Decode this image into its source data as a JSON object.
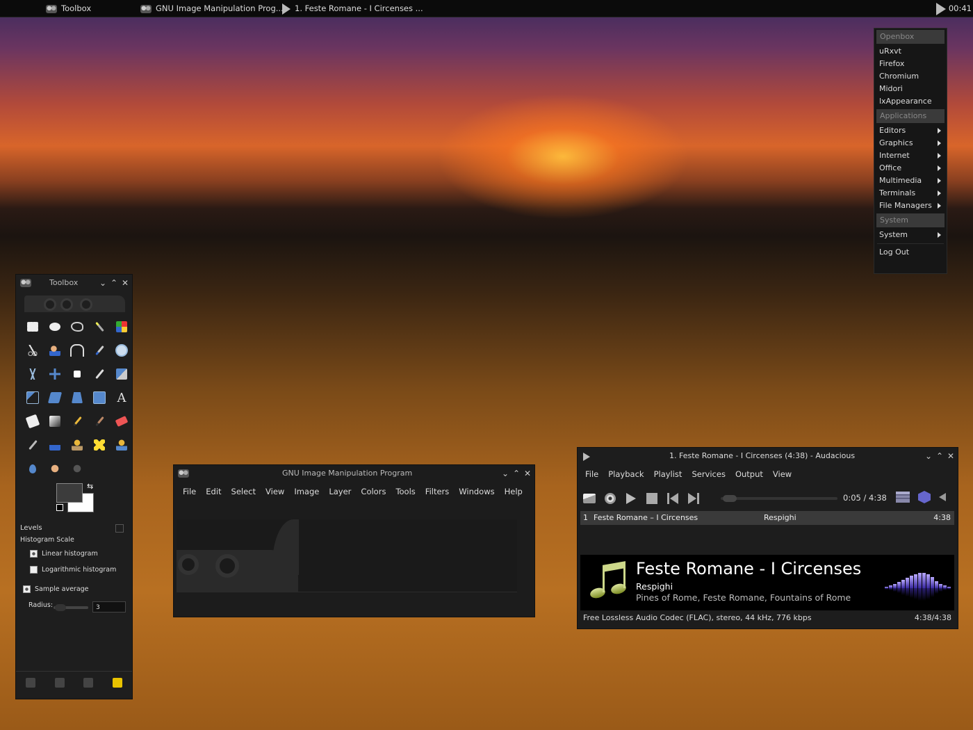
{
  "taskbar": {
    "tasks": [
      "Toolbox",
      "GNU Image Manipulation Prog...",
      "1. Feste Romane - I Circenses ..."
    ],
    "clock": "00:41"
  },
  "openbox_menu": {
    "header_openbox": "Openbox",
    "apps": [
      "uRxvt",
      "Firefox",
      "Chromium",
      "Midori",
      "lxAppearance"
    ],
    "header_applications": "Applications",
    "categories": [
      "Editors",
      "Graphics",
      "Internet",
      "Office",
      "Multimedia",
      "Terminals",
      "File Managers"
    ],
    "header_system": "System",
    "system_item": "System",
    "logout": "Log Out"
  },
  "toolbox": {
    "title": "Toolbox",
    "panel_title": "Levels",
    "histogram_scale": "Histogram Scale",
    "linear": "Linear histogram",
    "logarithmic": "Logarithmic histogram",
    "sample_average": "Sample average",
    "radius_label": "Radius:",
    "radius_value": "3",
    "colors": {
      "foreground": "#3c3c3c",
      "background": "#ffffff"
    }
  },
  "gimp": {
    "title": "GNU Image Manipulation Program",
    "menu": [
      "File",
      "Edit",
      "Select",
      "View",
      "Image",
      "Layer",
      "Colors",
      "Tools",
      "Filters",
      "Windows",
      "Help"
    ]
  },
  "audacious": {
    "title": "1. Feste Romane - I Circenses (4:38) - Audacious",
    "menu": [
      "File",
      "Playback",
      "Playlist",
      "Services",
      "Output",
      "View"
    ],
    "time": "0:05 / 4:38",
    "seek_fraction": 0.018,
    "playlist": [
      {
        "num": "1",
        "title": "Feste Romane – I Circenses",
        "artist": "Respighi",
        "length": "4:38"
      }
    ],
    "now_playing": {
      "title": "Feste Romane - I Circenses",
      "artist": "Respighi",
      "album": "Pines of Rome, Feste Romane, Fountains of Rome"
    },
    "status_left": "Free Lossless Audio Codec (FLAC), stereo, 44 kHz, 776 kbps",
    "status_right": "4:38/4:38"
  }
}
